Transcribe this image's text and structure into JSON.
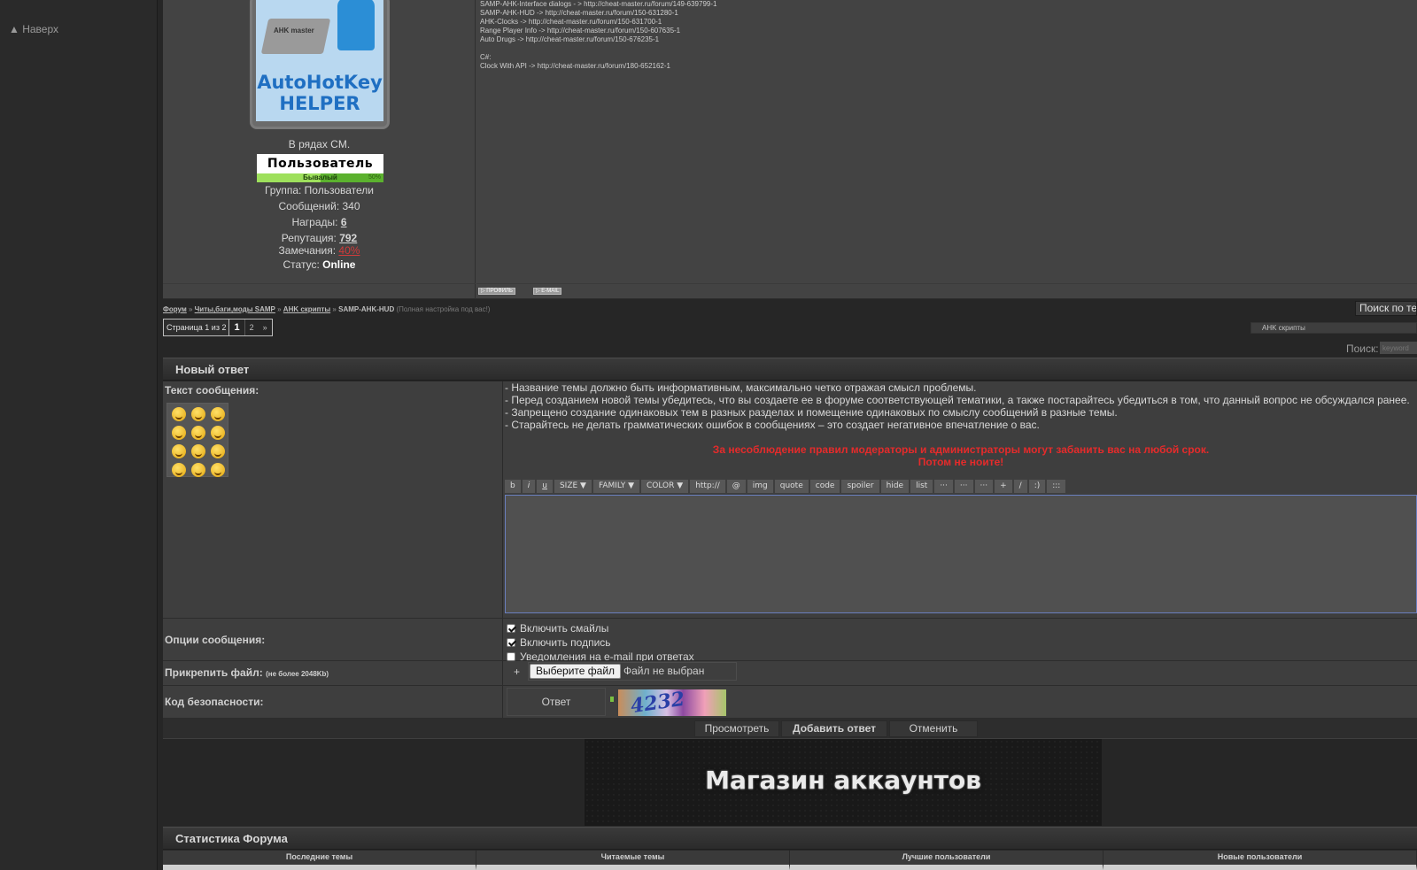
{
  "sidebar": {
    "to_top": "▲ Наверх"
  },
  "post": {
    "avatar": {
      "laptop_text": "AHK master",
      "title_line1": "AutoHotKey",
      "title_line2": "HELPER"
    },
    "joined": "В рядах CM.",
    "rank": "Пользователь",
    "rank_bar": {
      "label": "Бывалый",
      "percent_text": "50%",
      "progress": 0.5
    },
    "group": "Группа: Пользователи",
    "messages": "Сообщений: 340",
    "awards_label": "Награды: ",
    "awards_value": "6",
    "reputation_label": "Репутация: ",
    "reputation_value": "792",
    "warnings_label": "Замечания: ",
    "warnings_value": "40%",
    "status_label": "Статус: ",
    "status_value": "Online",
    "signature_lines": [
      "SAMP-AHK-Interface dialogs - > http://cheat-master.ru/forum/149-639799-1",
      "SAMP-AHK-HUD -> http://cheat-master.ru/forum/150-631280-1",
      "AHK-Clocks -> http://cheat-master.ru/forum/150-631700-1",
      "Range Player Info -> http://cheat-master.ru/forum/150-607635-1",
      "Auto Drugs -> http://cheat-master.ru/forum/150-676235-1",
      "",
      "C#:",
      "Clock With API -> http://cheat-master.ru/forum/180-652162-1"
    ],
    "buttons": {
      "profile": "▷ ПРОФИЛЬ",
      "email": "▷ E-MAIL"
    }
  },
  "breadcrumb": {
    "forum": "Форум",
    "section": "Читы,баги,моды SAMP",
    "subsection": "AHK скрипты",
    "topic": "SAMP-AHK-HUD",
    "topic_hint": "(Полная настройка под вас!)",
    "sep": " » "
  },
  "search_topic_button": "Поиск по теме",
  "pagination": {
    "label": "Страница 1 из 2",
    "current": "1",
    "next_page": "2",
    "next_arrow": "»"
  },
  "forum_select": {
    "value": "AHK скрипты"
  },
  "search": {
    "label": "Поиск:",
    "placeholder": "keyword"
  },
  "reply_form": {
    "title": "Новый ответ",
    "message_label": "Текст сообщения:",
    "rules": [
      "- Название темы должно быть информативным, максимально четко отражая смысл проблемы.",
      "- Перед созданием новой темы убедитесь, что вы создаете ее в форуме соответствующей тематики, а также постарайтесь убедиться в том, что данный вопрос не обсуждался ранее.",
      "- Запрещено создание одинаковых тем в разных разделах и помещение одинаковых по смыслу сообщений в разные темы.",
      "- Старайтесь не делать грамматических ошибок в сообщениях – это создает негативное впечатление о вас."
    ],
    "warning_line1": "За несоблюдение правил модераторы и администраторы могут забанить вас на любой срок.",
    "warning_line2": "Потом не ноите!",
    "toolbar": [
      "b",
      "i",
      "u",
      "SIZE ▼",
      "FAMILY ▼",
      "COLOR ▼",
      "http://",
      "@",
      "img",
      "quote",
      "code",
      "spoiler",
      "hide",
      "list",
      "···",
      "···",
      "···",
      "+",
      "/",
      ":)",
      ":::"
    ],
    "options_label": "Опции сообщения:",
    "options": [
      {
        "label": "Включить смайлы",
        "checked": true
      },
      {
        "label": "Включить подпись",
        "checked": true
      },
      {
        "label": "Уведомления на e-mail при ответах",
        "checked": false
      }
    ],
    "attach_label": "Прикрепить файл:",
    "attach_hint": "(не более 2048Kb)",
    "attach_plus": "+",
    "choose_file": "Выберите файл",
    "no_file": "Файл не выбран",
    "captcha_label": "Код безопасности:",
    "captcha_answer": "Ответ",
    "captcha_text": "4232",
    "preview_button": "Просмотреть",
    "submit_button": "Добавить ответ",
    "cancel_button": "Отменить"
  },
  "banner": {
    "text": "Магазин аккаунтов"
  },
  "stats": {
    "title": "Статистика Форума",
    "columns": [
      "Последние темы",
      "Читаемые темы",
      "Лучшие пользователи",
      "Новые пользователи"
    ]
  },
  "colors": {
    "warning_red": "#e52b2b",
    "rank_green": "#5bb12e",
    "textarea_border": "#6a7fbf"
  }
}
